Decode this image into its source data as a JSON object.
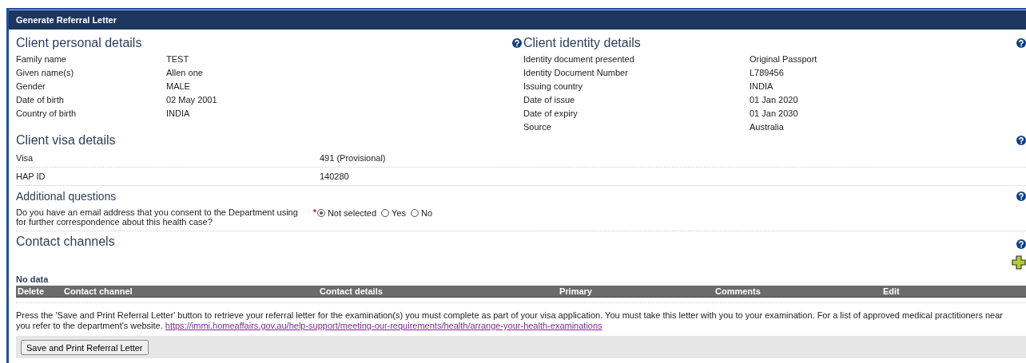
{
  "window": {
    "title": "Generate Referral Letter"
  },
  "personal": {
    "heading": "Client personal details",
    "fields": [
      {
        "label": "Family name",
        "value": "TEST"
      },
      {
        "label": "Given name(s)",
        "value": "Allen one"
      },
      {
        "label": "Gender",
        "value": "MALE"
      },
      {
        "label": "Date of birth",
        "value": "02 May 2001"
      },
      {
        "label": "Country of birth",
        "value": "INDIA"
      }
    ]
  },
  "identity": {
    "heading": "Client identity details",
    "fields": [
      {
        "label": "Identity document presented",
        "value": "Original Passport"
      },
      {
        "label": "Identity Document Number",
        "value": "L789456"
      },
      {
        "label": "Issuing country",
        "value": "INDIA"
      },
      {
        "label": "Date of issue",
        "value": "01 Jan 2020"
      },
      {
        "label": "Date of expiry",
        "value": "01 Jan 2030"
      },
      {
        "label": "Source",
        "value": "Australia"
      }
    ]
  },
  "visa": {
    "heading": "Client visa details",
    "fields": [
      {
        "label": "Visa",
        "value": "491 (Provisional)"
      },
      {
        "label": "HAP ID",
        "value": "140280"
      }
    ]
  },
  "additional": {
    "heading": "Additional questions",
    "question": "Do you have an email address that you consent to the Department using for further correspondence about this health case?",
    "required_mark": "*",
    "options": [
      {
        "label": "Not selected",
        "selected": true
      },
      {
        "label": "Yes",
        "selected": false
      },
      {
        "label": "No",
        "selected": false
      }
    ]
  },
  "contact": {
    "heading": "Contact channels",
    "empty_text": "No data",
    "columns": [
      "Delete",
      "Contact channel",
      "Contact details",
      "Primary",
      "Comments",
      "Edit"
    ]
  },
  "instructions": {
    "text": "Press the 'Save and Print Referral Letter' button to retrieve your referral letter for the examination(s) you must complete as part of your visa application. You must take this letter with you to your examination. For a list of approved medical practitioners near you refer to the department's website.",
    "link": "https://immi.homeaffairs.gov.au/help-support/meeting-our-requirements/health/arrange-your-health-examinations"
  },
  "buttons": [
    "Save and Print Referral Letter"
  ]
}
